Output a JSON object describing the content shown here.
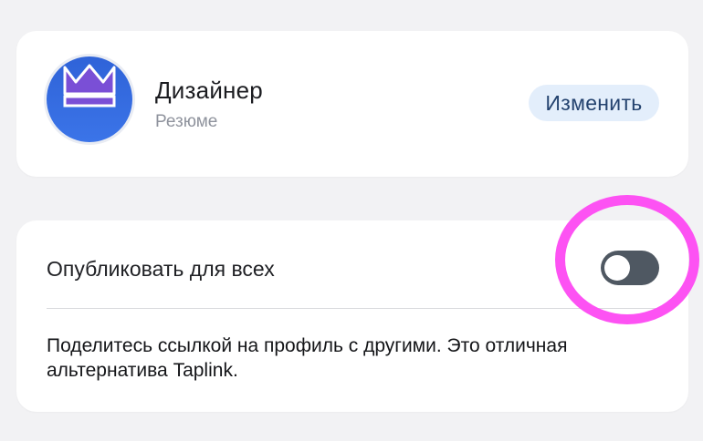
{
  "profile": {
    "name": "Дизайнер",
    "subtitle": "Резюме",
    "avatar_icon": "crown-icon",
    "edit_label": "Изменить",
    "colors": {
      "avatar_bg": "#3a6fe0",
      "crown": "#7a4fd6",
      "edit_bg": "#e3eefb",
      "edit_text": "#24436f"
    }
  },
  "publish": {
    "label": "Опубликовать для всех",
    "toggle_on": false,
    "description": "Поделитесь ссылкой на профиль с другими. Это отличная альтернатива Taplink.",
    "colors": {
      "toggle_track": "#4f5862",
      "highlight": "#fd52f3"
    }
  }
}
